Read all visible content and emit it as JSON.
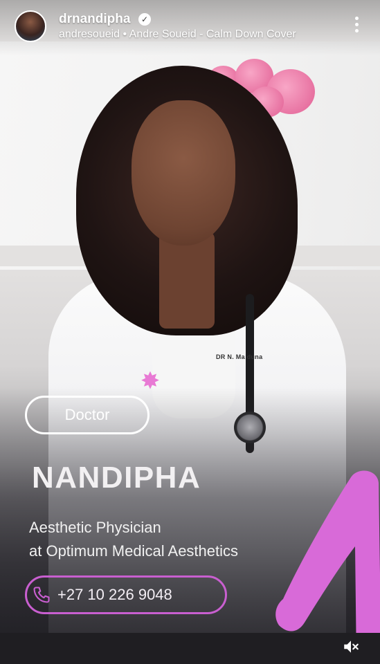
{
  "header": {
    "username": "drnandipha",
    "verified_badge": "✓",
    "audio_credit": "andresoueid • Andre Soueid - Calm Down Cover"
  },
  "promo": {
    "nametag": "DR N. Ma    duna",
    "role_tag": "Doctor",
    "name": "NANDIPHA",
    "title_line1": "Aesthetic Physician",
    "title_line2": "at Optimum Medical Aesthetics",
    "phone": "+27 10 226 9048"
  },
  "icons": {
    "avatar": "profile-avatar",
    "verified": "verified-badge-icon",
    "more": "more-vertical-icon",
    "phone": "phone-icon",
    "sparkle": "sparkle-icon",
    "mute": "speaker-muted-icon"
  },
  "colors": {
    "accent_pink": "#c95fd0",
    "magenta_shape": "#d86ad8",
    "text_light": "#f2f0f2"
  }
}
